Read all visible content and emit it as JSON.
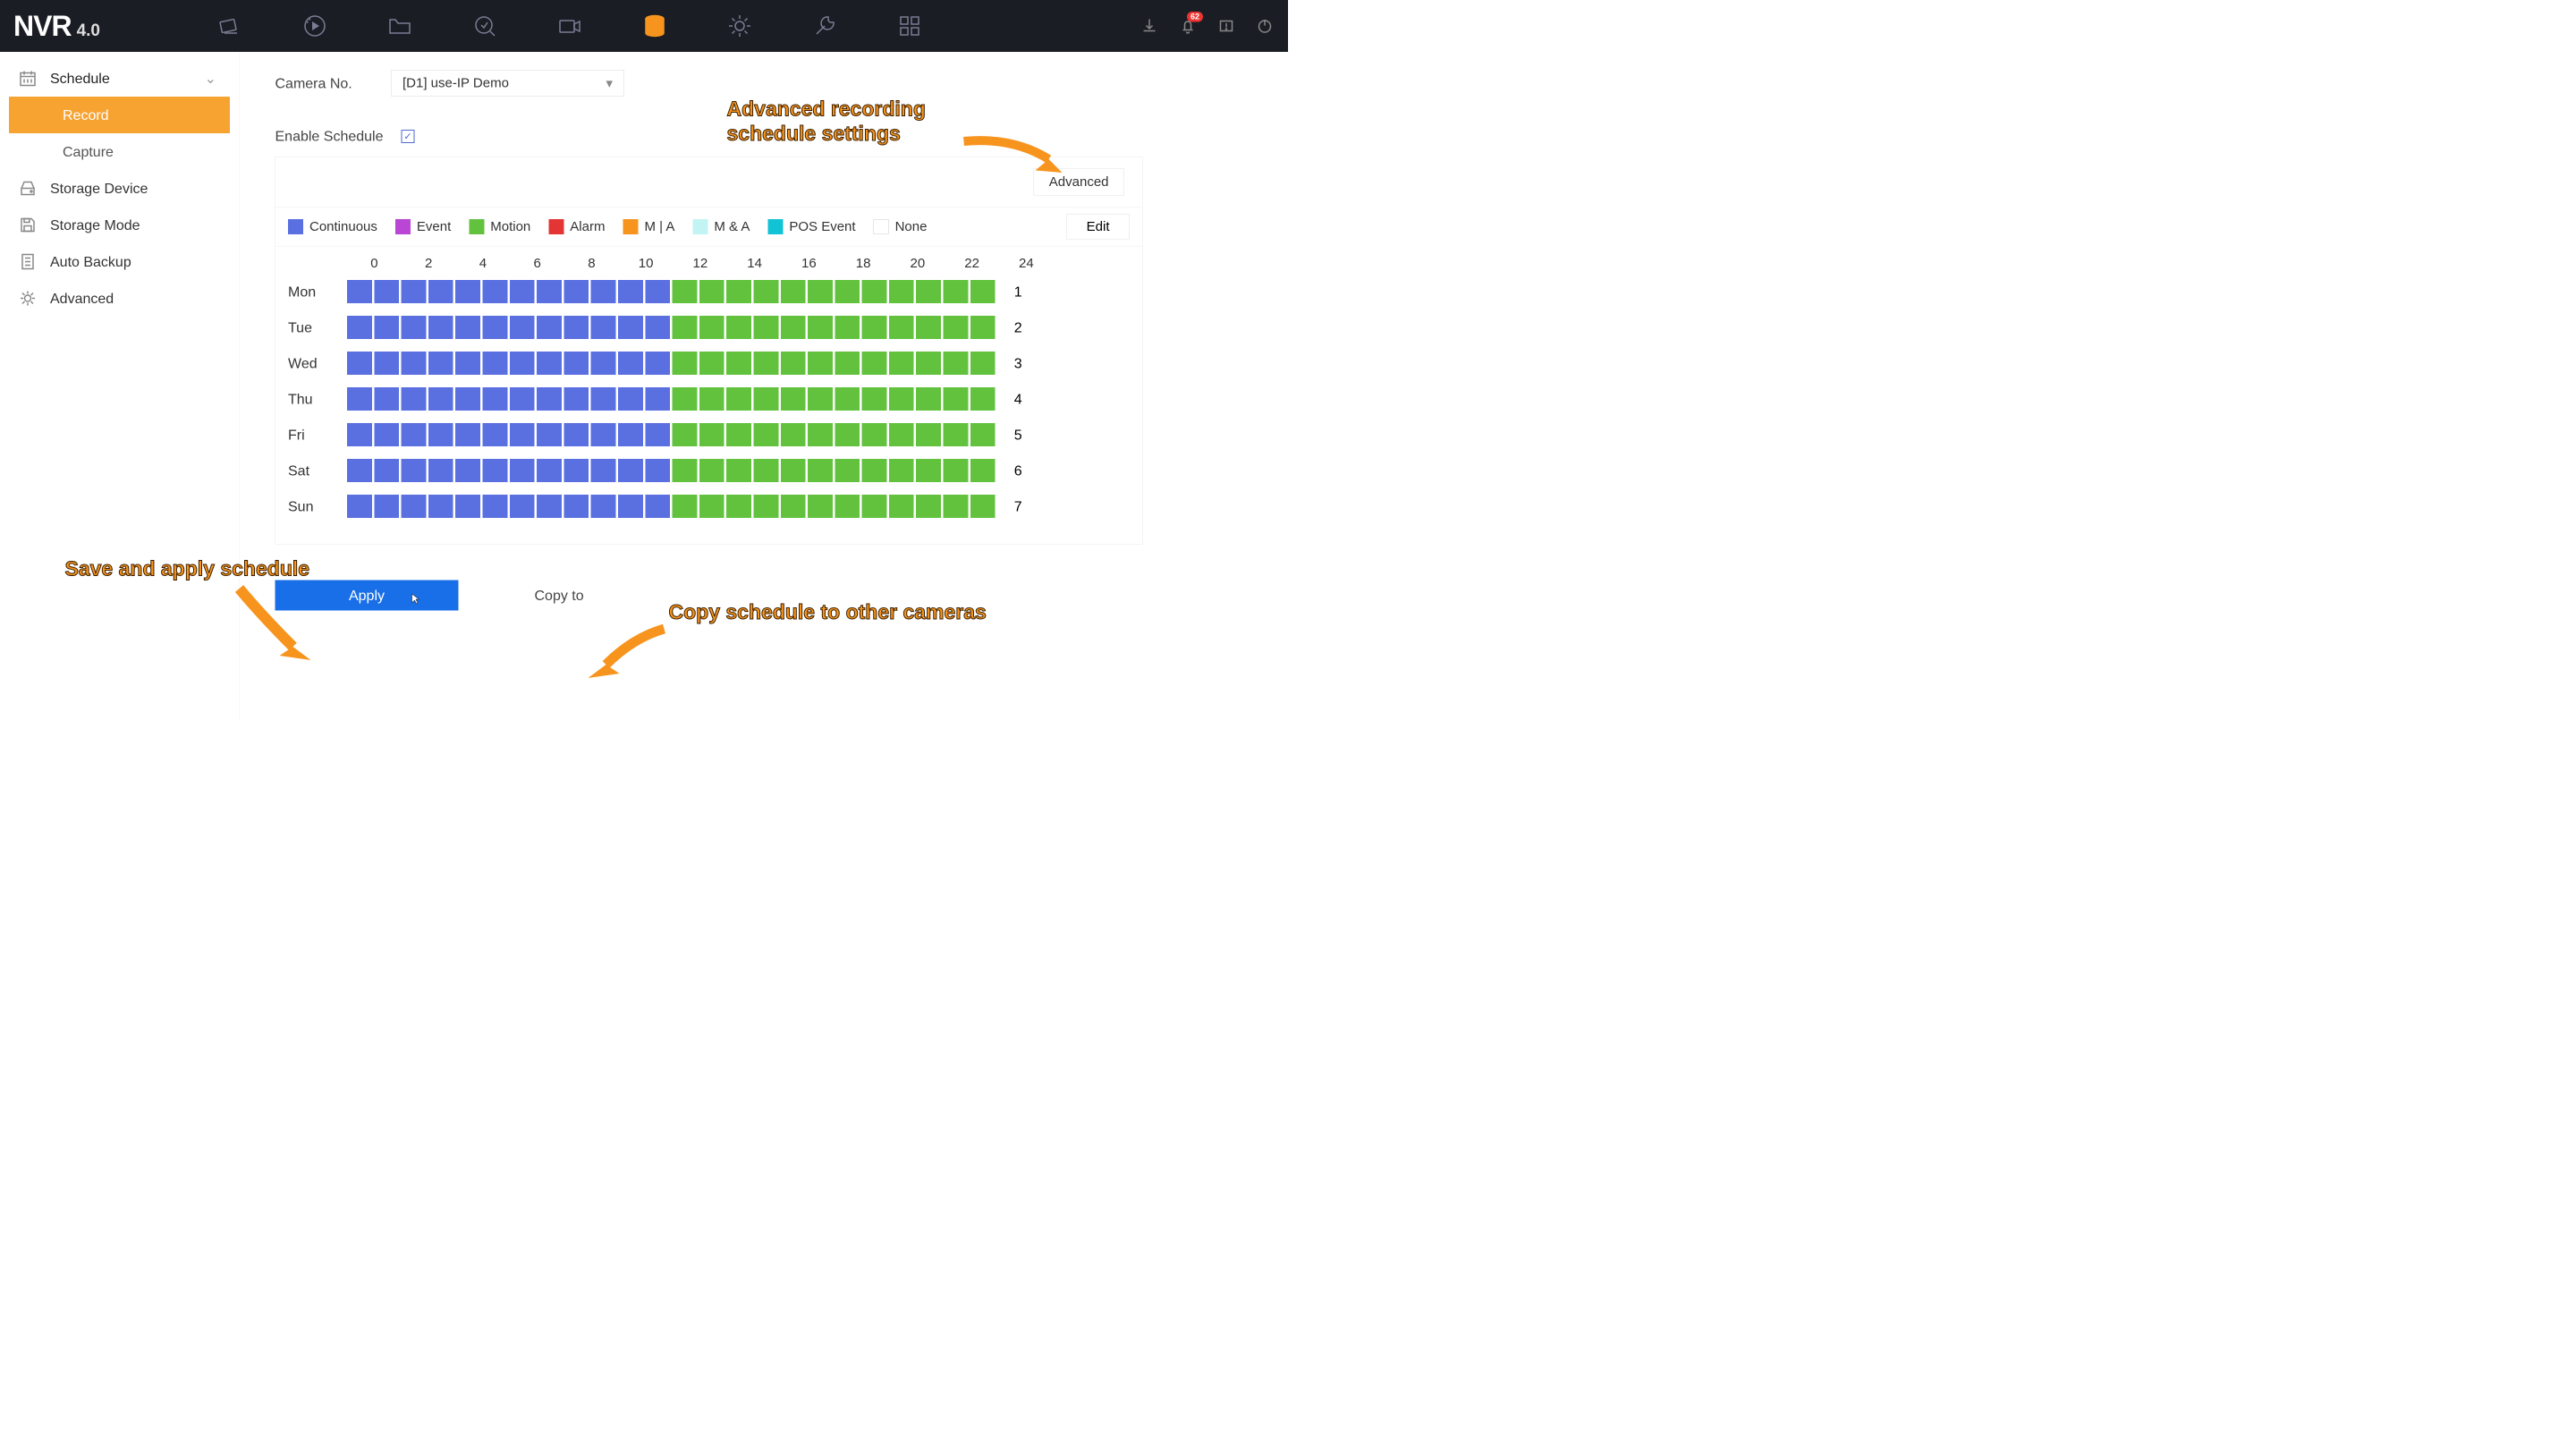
{
  "logo": {
    "brand": "NVR",
    "version": "4.0"
  },
  "tray": {
    "badge": "62"
  },
  "sidebar": {
    "schedule": "Schedule",
    "record": "Record",
    "capture": "Capture",
    "storage_device": "Storage Device",
    "storage_mode": "Storage Mode",
    "auto_backup": "Auto Backup",
    "advanced": "Advanced"
  },
  "form": {
    "camera_label": "Camera No.",
    "camera_value": "[D1] use-IP Demo",
    "enable_label": "Enable Schedule",
    "advanced_btn": "Advanced",
    "edit_btn": "Edit"
  },
  "legend": {
    "continuous": "Continuous",
    "event": "Event",
    "motion": "Motion",
    "alarm": "Alarm",
    "mia": "M | A",
    "manda": "M & A",
    "pos": "POS Event",
    "none": "None"
  },
  "colors": {
    "continuous": "#5a6fe0",
    "event": "#b946d4",
    "motion": "#62c23e",
    "alarm": "#e43535",
    "mia": "#f7941e",
    "manda": "#c2f4f3",
    "pos": "#12c3d6"
  },
  "hours": [
    "0",
    "2",
    "4",
    "6",
    "8",
    "10",
    "12",
    "14",
    "16",
    "18",
    "20",
    "22",
    "24"
  ],
  "days": [
    {
      "label": "Mon",
      "num": "1"
    },
    {
      "label": "Tue",
      "num": "2"
    },
    {
      "label": "Wed",
      "num": "3"
    },
    {
      "label": "Thu",
      "num": "4"
    },
    {
      "label": "Fri",
      "num": "5"
    },
    {
      "label": "Sat",
      "num": "6"
    },
    {
      "label": "Sun",
      "num": "7"
    }
  ],
  "schedule_split_hour": 12,
  "buttons": {
    "apply": "Apply",
    "copy": "Copy to"
  },
  "annotations": {
    "advanced": "Advanced recording\nschedule settings",
    "save": "Save and apply schedule",
    "copy": "Copy schedule to other cameras"
  }
}
